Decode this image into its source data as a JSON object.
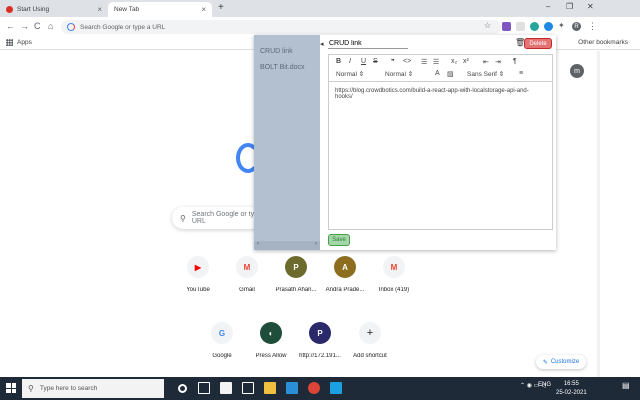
{
  "browser": {
    "tabs": [
      {
        "label": "Start Using",
        "close": "×"
      },
      {
        "label": "New Tab",
        "close": "×"
      }
    ],
    "new_tab": "+",
    "window_controls": [
      "–",
      "❐",
      "✕"
    ],
    "nav": {
      "back": "←",
      "forward": "→",
      "reload": "C",
      "home": "⌂"
    },
    "omnibox_placeholder": "Search Google or type a URL",
    "star": "☆",
    "profile_initial": "R",
    "menu": "⋮",
    "bookmarks": {
      "apps_label": "Apps",
      "other": "Other bookmarks"
    }
  },
  "newtab": {
    "search_placeholder": "Search Google or type a URL",
    "account_initial": "m",
    "shortcuts": [
      {
        "label": "YouTube",
        "glyph": "▶",
        "color": "#ff0000"
      },
      {
        "label": "Gmail",
        "glyph": "M",
        "color": "#ea4335"
      },
      {
        "label": "Prasath Ahan...",
        "glyph": "P",
        "color": "#6d6a2e"
      },
      {
        "label": "Andra Prade...",
        "glyph": "A",
        "color": "#8d6e1e"
      },
      {
        "label": "Inbox (419)",
        "glyph": "M",
        "color": "#ea4335"
      },
      {
        "label": "Google",
        "glyph": "G",
        "color": "#4285f4"
      },
      {
        "label": "Press Allow",
        "glyph": "◐",
        "color": "#1e4d3b"
      },
      {
        "label": "http://172.191...",
        "glyph": "P",
        "color": "#2a2a6a"
      },
      {
        "label": "Add shortcut",
        "glyph": "+",
        "color": "#3c4043"
      }
    ],
    "customize": "Customize"
  },
  "popup": {
    "sidebar_items": [
      "CRUD link",
      "BOLT Bit.docx"
    ],
    "sidebar_scroll": {
      "left": "‹",
      "right": "›"
    },
    "back_arrow": "◂",
    "title_value": "CRUD link",
    "trash_icon": "🗑",
    "delete_label": "Delete",
    "toolbar": {
      "bold": "B",
      "italic": "I",
      "underline": "U",
      "strike": "S",
      "quote": "❞",
      "code": "<>",
      "ol": "☰",
      "ul": "☰",
      "sub": "x₂",
      "sup": "x²",
      "outdent": "⇤",
      "indent": "⇥",
      "rtl": "¶",
      "header_select": "Normal",
      "size_select": "Normal",
      "color": "A",
      "background": "▨",
      "font_select": "Sans Serif",
      "align": "≡"
    },
    "content": "https://blog.crowdbotics.com/build-a-react-app-with-localstorage-api-and-hooks/",
    "save_label": "Save"
  },
  "taskbar": {
    "search_placeholder": "Type here to search",
    "tray": {
      "lang": "ENG",
      "time": "16:55",
      "date": "25-02-2021"
    }
  },
  "colors": {
    "sidebar": "#b3c0cf",
    "delete": "#e57373",
    "save": "#a5d6a7",
    "taskbar": "#1f2a38"
  }
}
